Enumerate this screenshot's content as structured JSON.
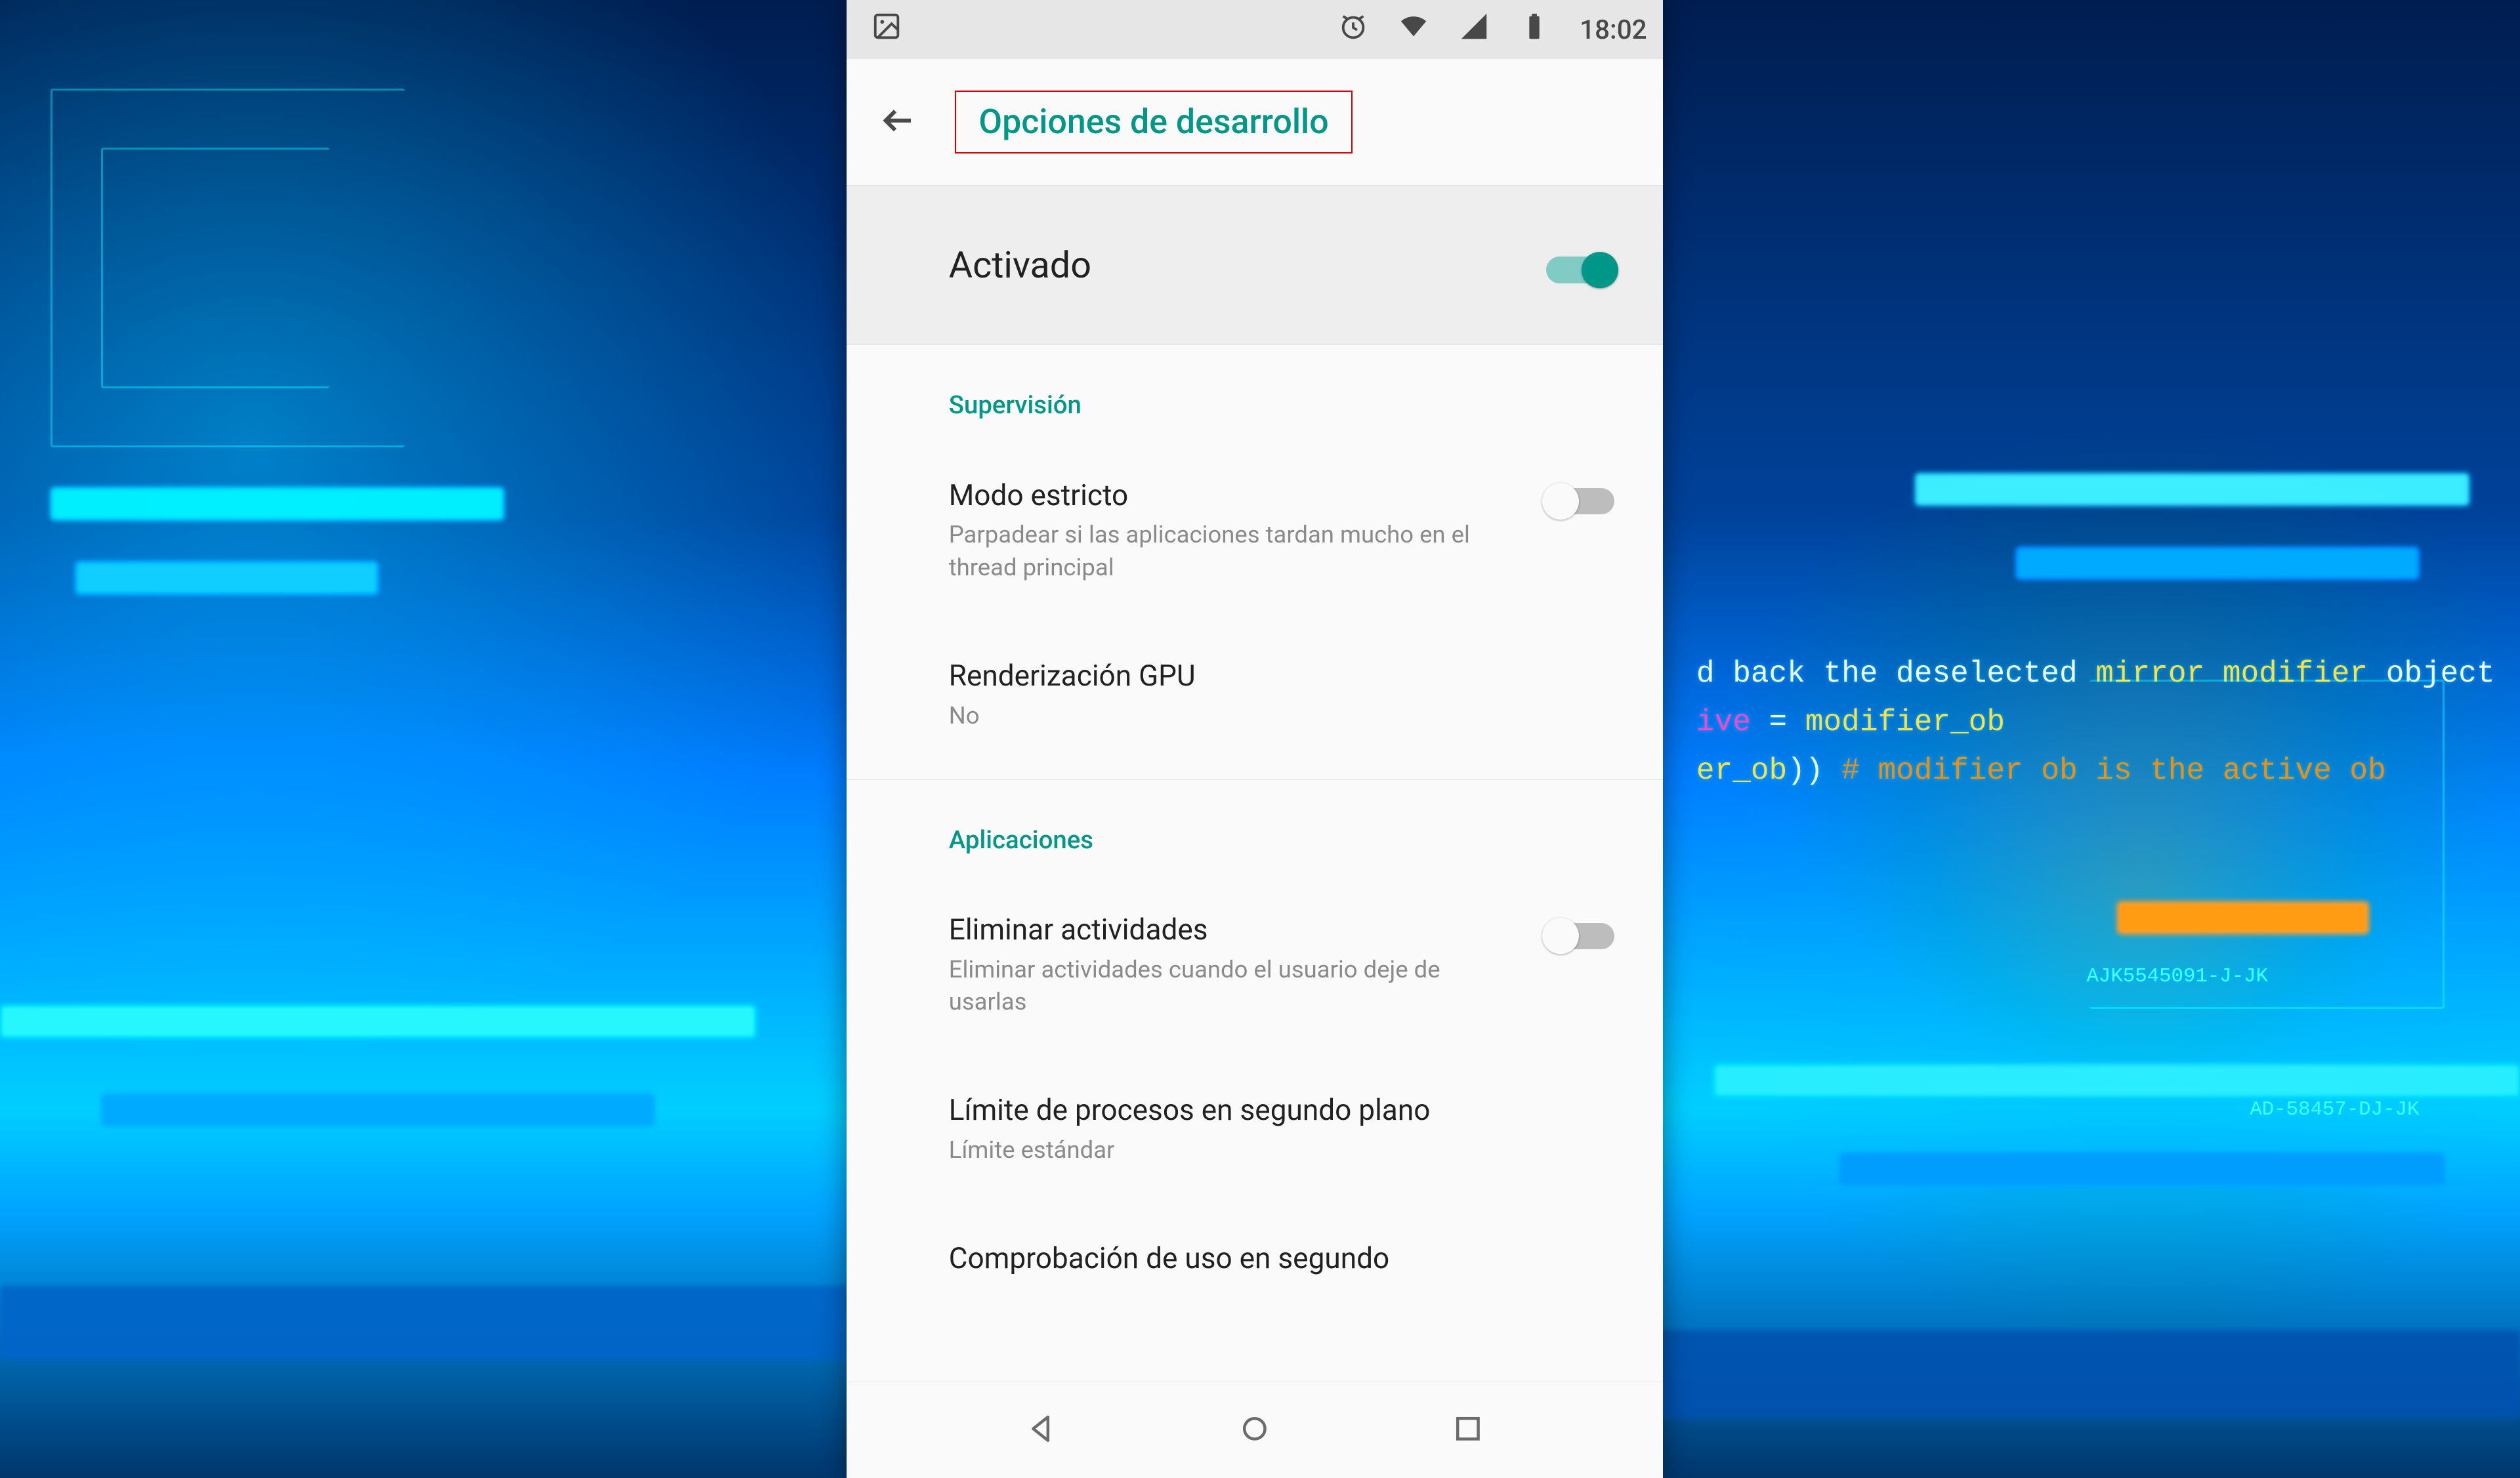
{
  "statusbar": {
    "time": "18:02"
  },
  "appbar": {
    "title": "Opciones de desarrollo"
  },
  "master": {
    "label": "Activado",
    "on": true
  },
  "sections": {
    "supervision": {
      "label": "Supervisión",
      "strict": {
        "title": "Modo estricto",
        "desc": "Parpadear si las aplicaciones tardan mucho en el thread principal",
        "on": false
      },
      "gpu": {
        "title": "Renderización GPU",
        "desc": "No"
      }
    },
    "apps": {
      "label": "Aplicaciones",
      "kill": {
        "title": "Eliminar actividades",
        "desc": "Eliminar actividades cuando el usuario deje de usarlas",
        "on": false
      },
      "limit": {
        "title": "Límite de procesos en segundo plano",
        "desc": "Límite estándar"
      },
      "verify": {
        "title": "Comprobación de uso en segundo"
      }
    }
  },
  "bg_code": {
    "l1a": "d back the deselected ",
    "l1b": "mirror modifier",
    "l1c": " object",
    "l2a": "ive",
    "l2b": " = ",
    "l2c": "modifier_ob",
    "l3a": "er_ob",
    "l3b": ")) ",
    "l3c": "# modifier ob is the active ob",
    "l5": "AJK5545091-J-JK",
    "l6": "AD-58457-DJ-JK"
  }
}
